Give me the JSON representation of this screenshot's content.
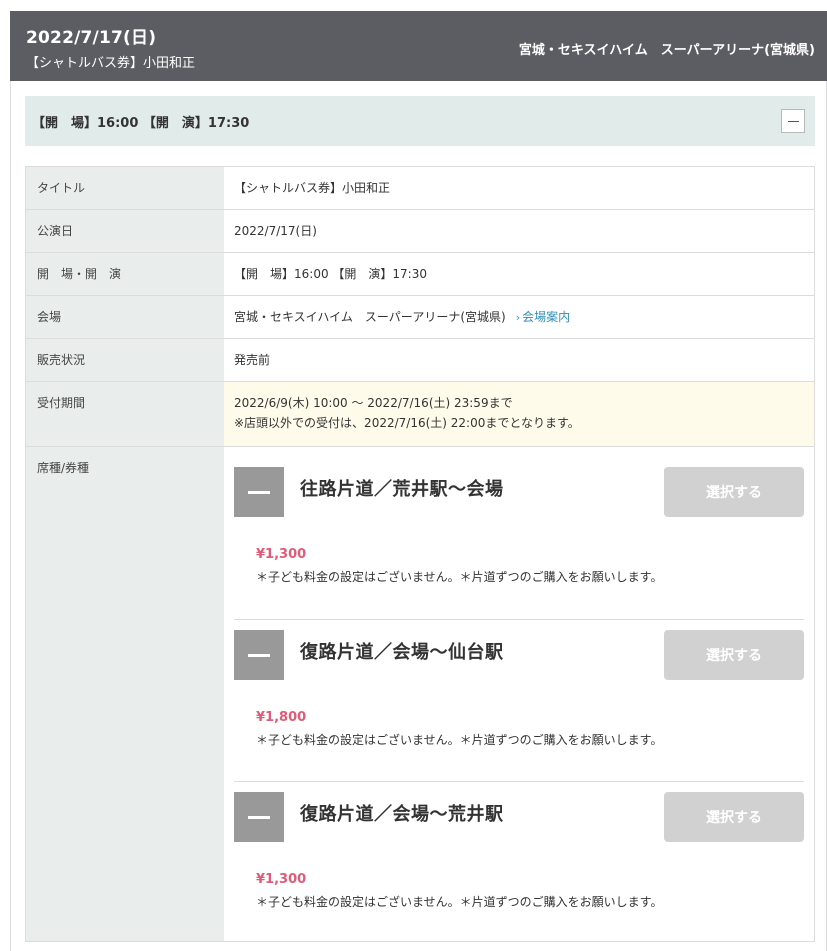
{
  "header": {
    "date": "2022/7/17(日)",
    "subtitle": "【シャトルバス券】小田和正",
    "venue": "宮城・セキスイハイム　スーパーアリーナ(宮城県)"
  },
  "open_bar": {
    "text": "【開　場】16:00 【開　演】17:30"
  },
  "details": {
    "title_label": "タイトル",
    "title_value": "【シャトルバス券】小田和正",
    "date_label": "公演日",
    "date_value": "2022/7/17(日)",
    "time_label": "開　場・開　演",
    "time_value": "【開　場】16:00 【開　演】17:30",
    "venue_label": "会場",
    "venue_value": "宮城・セキスイハイム　スーパーアリーナ(宮城県)",
    "venue_link_icon": "chevron-right-icon",
    "venue_link": "会場案内",
    "sales_label": "販売状況",
    "sales_value": "発売前",
    "reception_label": "受付期間",
    "reception_value": "2022/6/9(木) 10:00 ～ 2022/7/16(土) 23:59まで",
    "reception_note": "※店頭以外での受付は、2022/7/16(土) 22:00までとなります。",
    "seat_label": "席種/券種"
  },
  "tickets": [
    {
      "name": "往路片道／荒井駅～会場",
      "select_label": "選択する",
      "price": "¥1,300",
      "note": "＊子ども料金の設定はございません。＊片道ずつのご購入をお願いします。"
    },
    {
      "name": "復路片道／会場～仙台駅",
      "select_label": "選択する",
      "price": "¥1,800",
      "note": "＊子ども料金の設定はございません。＊片道ずつのご購入をお願いします。"
    },
    {
      "name": "復路片道／会場～荒井駅",
      "select_label": "選択する",
      "price": "¥1,300",
      "note": "＊子ども料金の設定はございません。＊片道ずつのご購入をお願いします。"
    }
  ],
  "colors": {
    "header_bg": "#5c5c63",
    "open_bar_bg": "#e1ebe9",
    "label_bg": "#e9edec",
    "price": "#e05b78",
    "link": "#2f8fb9",
    "disabled_button": "#d1d1d1",
    "reception_bg": "#fffbeb"
  }
}
